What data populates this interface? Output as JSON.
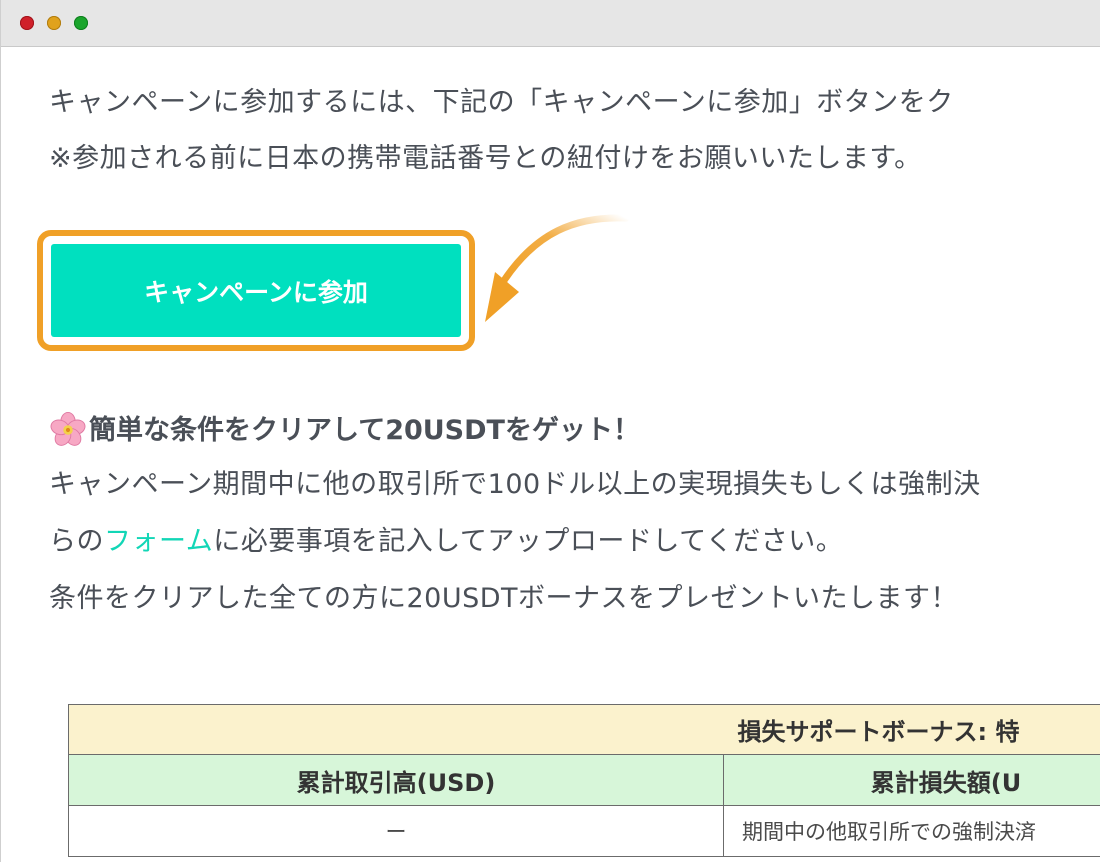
{
  "window": {
    "controls": [
      "close",
      "minimize",
      "zoom"
    ]
  },
  "intro": {
    "line1": "キャンペーンに参加するには、下記の「キャンペーンに参加」ボタンをク",
    "line2": "※参加される前に日本の携帯電話番号との紐付けをお願いいたします。"
  },
  "cta": {
    "label": "キャンペーンに参加",
    "button_color": "#00e0bf",
    "highlight_color": "#f0a027"
  },
  "details": {
    "title": "簡単な条件をクリアして20USDTをゲット！",
    "title_icon": "cherry-blossom-icon",
    "line1": "キャンペーン期間中に他の取引所で100ドル以上の実現損失もしくは強制決",
    "line2_before": "らの",
    "line2_link": "フォーム",
    "line2_after": "に必要事項を記入してアップロードしてください。",
    "line3": "条件をクリアした全ての方に20USDTボーナスをプレゼントいたします！",
    "link_color": "#12d6b6"
  },
  "table": {
    "banner": "損失サポートボーナス: 特",
    "headers": [
      "累計取引高(USD)",
      "累計損失額(U"
    ],
    "rows": [
      [
        "ー",
        "期間中の他取引所での強制決済 "
      ]
    ]
  }
}
